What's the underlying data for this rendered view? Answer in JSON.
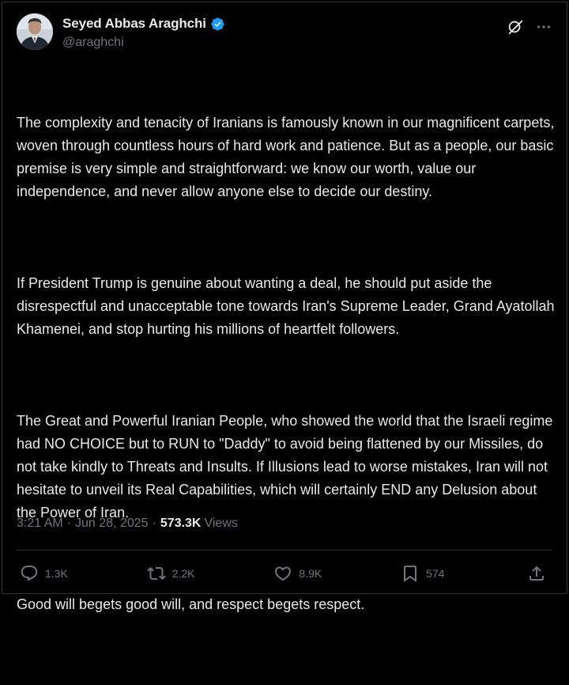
{
  "author": {
    "display_name": "Seyed Abbas Araghchi",
    "handle": "@araghchi",
    "verified": true
  },
  "icons": {
    "verified": "verified-badge-icon",
    "grok": "grok-icon",
    "more": "more-dots-icon",
    "reply": "reply-icon",
    "repost": "repost-icon",
    "like": "like-icon",
    "bookmark": "bookmark-icon",
    "share": "share-icon"
  },
  "tweet": {
    "paragraphs": [
      "The complexity and tenacity of Iranians is famously known in our magnificent carpets, woven through countless hours of hard work and patience. But as a people, our basic premise is very simple and straightforward: we know our worth, value our independence, and never allow anyone else to decide our destiny.",
      "If President Trump is genuine about wanting a deal, he should put aside the disrespectful and unacceptable tone towards Iran's Supreme Leader, Grand Ayatollah Khamenei, and stop hurting his millions of heartfelt followers.",
      "The Great and Powerful Iranian People, who showed the world that the Israeli regime had NO CHOICE but to RUN to \"Daddy\" to avoid being flattened by our Missiles, do not take kindly to Threats and Insults. If Illusions lead to worse mistakes, Iran will not hesitate to unveil its Real Capabilities, which will certainly END any Delusion about the Power of Iran.",
      "Good will begets good will, and respect begets respect."
    ],
    "time": "3:21 AM",
    "separator": "·",
    "date": "Jun 28, 2025",
    "views_count": "573.3K",
    "views_label": "Views"
  },
  "engagement": {
    "replies": "1.3K",
    "reposts": "2.2K",
    "likes": "8.9K",
    "bookmarks": "574"
  },
  "colors": {
    "background": "#000000",
    "text_primary": "#e7e9ea",
    "text_secondary": "#71767b",
    "divider": "#2f3336",
    "verified_blue": "#1d9bf0"
  }
}
